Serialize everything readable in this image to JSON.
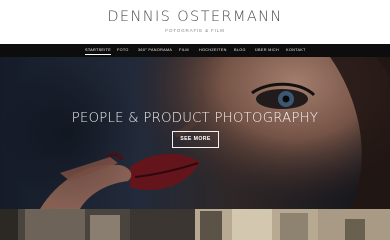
{
  "header": {
    "title": "DENNIS OSTERMANN",
    "subtitle": "FOTOGRAFIE & FILM"
  },
  "nav": {
    "items": [
      {
        "label": "STARTSEITE",
        "active": true
      },
      {
        "label": "FOTO",
        "active": false
      },
      {
        "label": "360° PANORAMA",
        "active": false
      },
      {
        "label": "FILM",
        "active": false
      },
      {
        "label": "HOCHZEITEN",
        "active": false
      },
      {
        "label": "BLOG",
        "active": false
      },
      {
        "label": "ÜBER MICH",
        "active": false
      },
      {
        "label": "KONTAKT",
        "active": false
      }
    ]
  },
  "hero": {
    "heading": "PEOPLE & PRODUCT PHOTOGRAPHY",
    "button_label": "SEE MORE"
  },
  "colors": {
    "nav_background": "#0d0d0d",
    "hero_overlay": "#1d2636",
    "title_text": "#4a4a4a"
  }
}
